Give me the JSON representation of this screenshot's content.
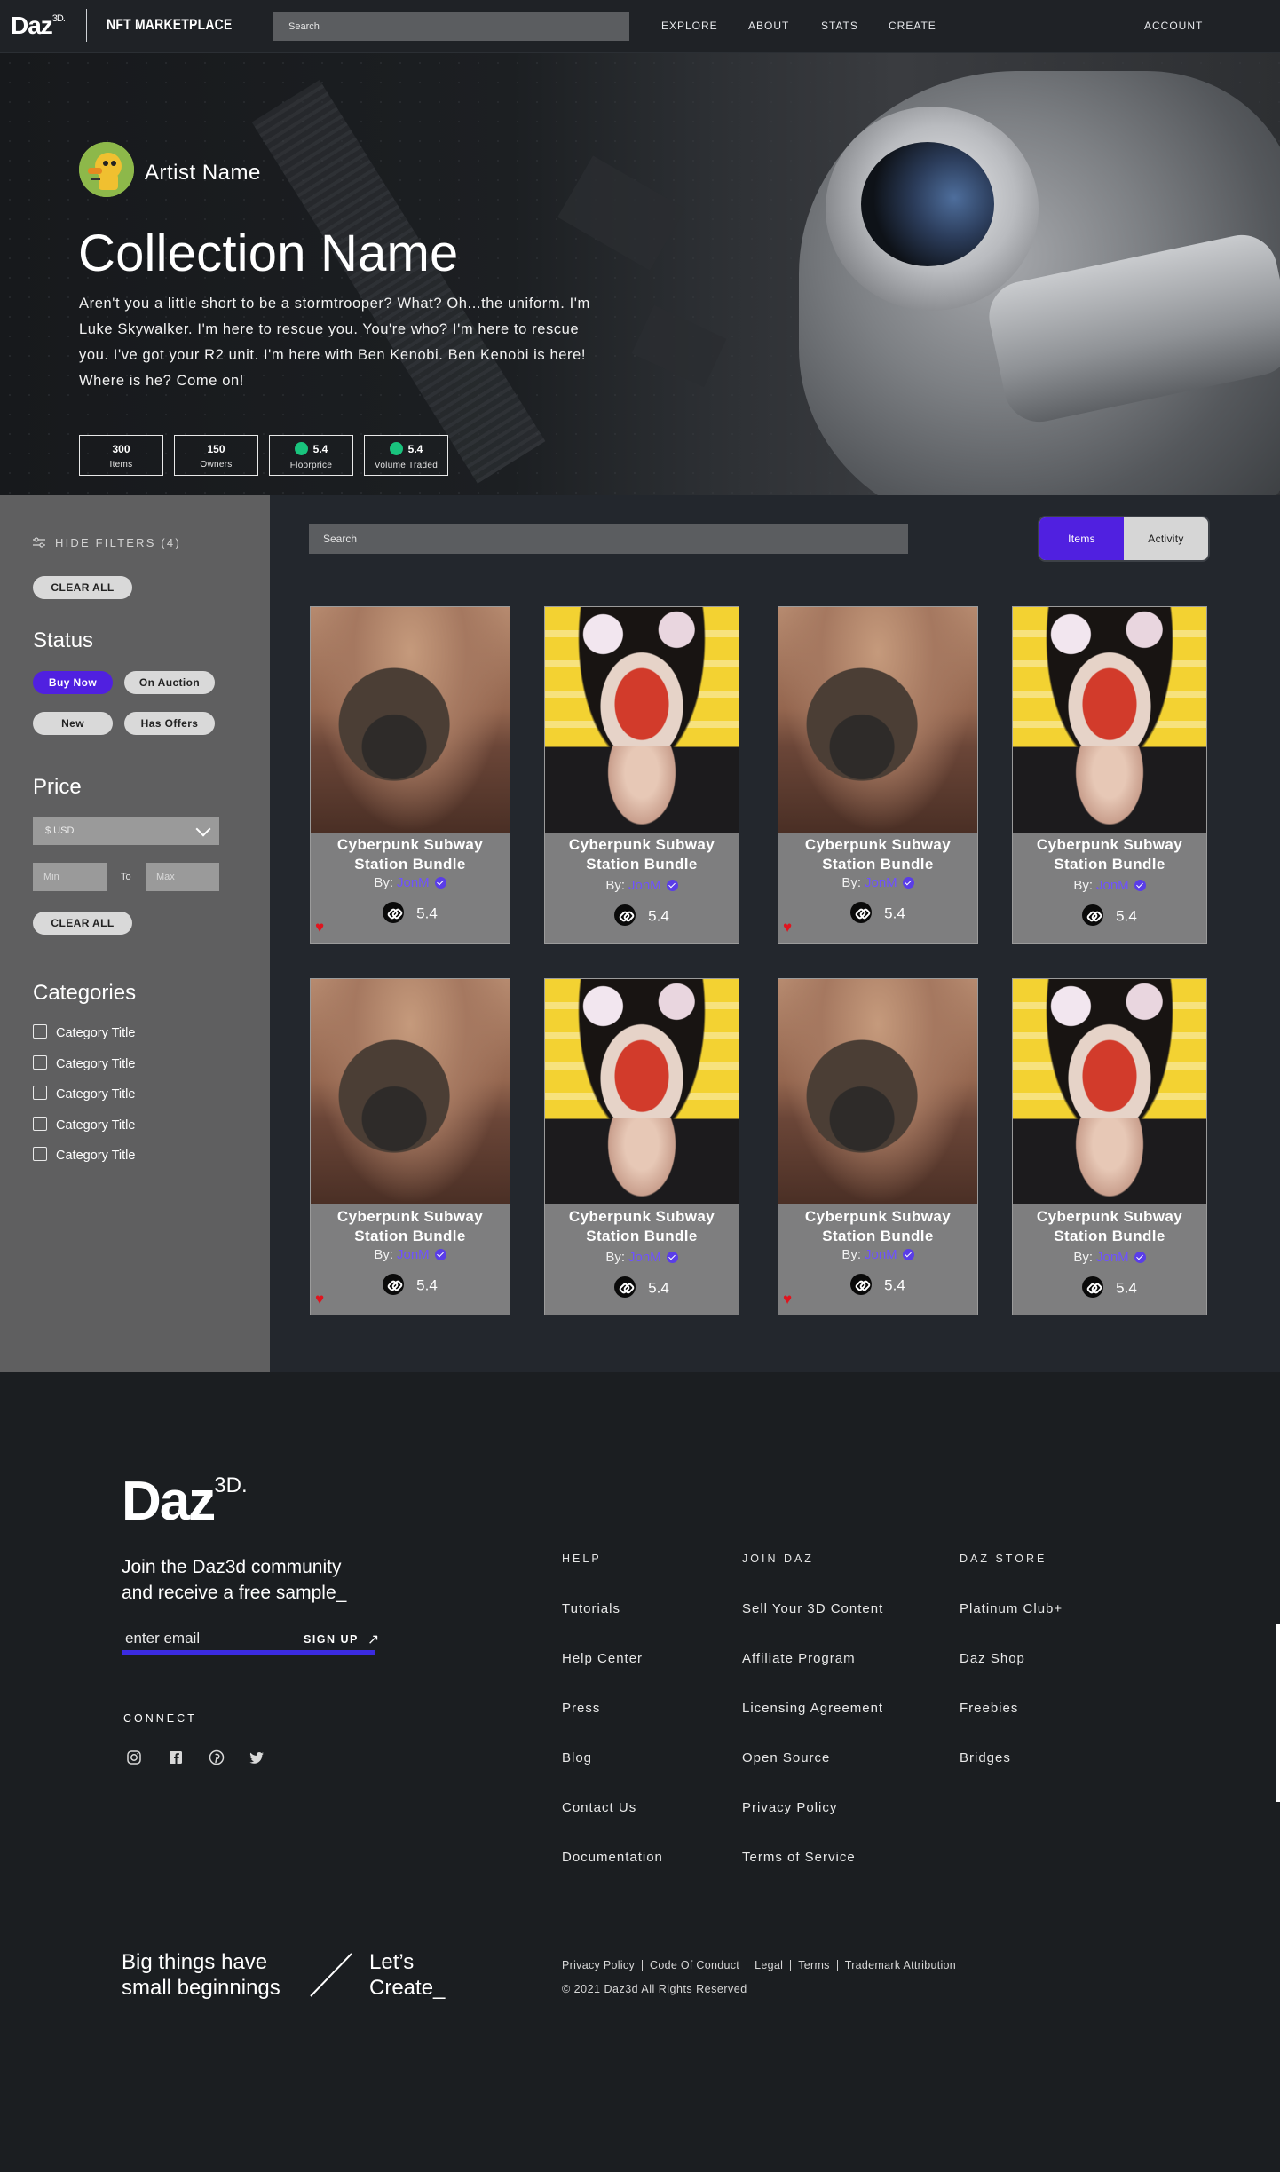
{
  "nav": {
    "logo": "Daz",
    "logo_sup": "3D.",
    "brand": "NFT MARKETPLACE",
    "search_placeholder": "Search",
    "links": [
      "EXPLORE",
      "ABOUT",
      "STATS",
      "CREATE"
    ],
    "account": "ACCOUNT"
  },
  "hero": {
    "artist_name": "Artist Name",
    "collection_name": "Collection Name",
    "description": "Aren't you a little short to be a stormtrooper? What? Oh...the uniform. I'm Luke Skywalker. I'm here to rescue you. You're who? I'm here to rescue you. I've got your R2 unit. I'm here with Ben Kenobi. Ben Kenobi is here! Where is he? Come on!",
    "stats": [
      {
        "value": "300",
        "label": "Items"
      },
      {
        "value": "150",
        "label": "Owners"
      },
      {
        "value": "5.4",
        "label": "Floorprice"
      },
      {
        "value": "5.4",
        "label": "Volume Traded"
      }
    ]
  },
  "filters": {
    "hide_filters": "HIDE FILTERS (4)",
    "clear_all": "CLEAR ALL",
    "status_heading": "Status",
    "status_options": [
      "Buy Now",
      "On Auction",
      "New",
      "Has Offers"
    ],
    "price_heading": "Price",
    "currency": "$ USD",
    "min_placeholder": "Min",
    "to": "To",
    "max_placeholder": "Max",
    "price_clear_all": "CLEAR ALL",
    "categories_heading": "Categories",
    "categories": [
      "Category Title",
      "Category Title",
      "Category Title",
      "Category Title",
      "Category Title"
    ]
  },
  "main": {
    "search_placeholder": "Search",
    "tabs": [
      "Items",
      "Activity"
    ]
  },
  "cards": [
    {
      "title": "Cyberpunk Subway Station Bundle",
      "by": "By:",
      "author": "JonM",
      "price": "5.4",
      "image": "desert-capsule",
      "liked": true
    },
    {
      "title": "Cyberpunk Subway Station Bundle",
      "by": "By:",
      "author": "JonM",
      "price": "5.4",
      "image": "geisha-portrait",
      "liked": false
    },
    {
      "title": "Cyberpunk Subway Station Bundle",
      "by": "By:",
      "author": "JonM",
      "price": "5.4",
      "image": "desert-capsule",
      "liked": true
    },
    {
      "title": "Cyberpunk Subway Station Bundle",
      "by": "By:",
      "author": "JonM",
      "price": "5.4",
      "image": "geisha-portrait",
      "liked": false
    },
    {
      "title": "Cyberpunk Subway Station Bundle",
      "by": "By:",
      "author": "JonM",
      "price": "5.4",
      "image": "desert-capsule",
      "liked": true
    },
    {
      "title": "Cyberpunk Subway Station Bundle",
      "by": "By:",
      "author": "JonM",
      "price": "5.4",
      "image": "geisha-portrait",
      "liked": false
    },
    {
      "title": "Cyberpunk Subway Station Bundle",
      "by": "By:",
      "author": "JonM",
      "price": "5.4",
      "image": "desert-capsule",
      "liked": true
    },
    {
      "title": "Cyberpunk Subway Station Bundle",
      "by": "By:",
      "author": "JonM",
      "price": "5.4",
      "image": "geisha-portrait",
      "liked": false
    }
  ],
  "footer": {
    "logo": "Daz",
    "logo_sup": "3D.",
    "join_line1": "Join the Daz3d community",
    "join_line2": "and receive a free sample_",
    "email_placeholder": "enter email",
    "sign_up": "SIGN UP",
    "connect": "CONNECT",
    "social_icons": [
      "instagram-icon",
      "facebook-icon",
      "pinterest-icon",
      "twitter-icon"
    ],
    "columns": [
      {
        "heading": "HELP",
        "links": [
          "Tutorials",
          "Help Center",
          "Press",
          "Blog",
          "Contact Us",
          "Documentation"
        ]
      },
      {
        "heading": "JOIN DAZ",
        "links": [
          "Sell Your 3D Content",
          "Affiliate Program",
          "Licensing Agreement",
          "Open Source",
          "Privacy Policy",
          "Terms of Service"
        ]
      },
      {
        "heading": "DAZ STORE",
        "links": [
          "Platinum Club+",
          "Daz Shop",
          "Freebies",
          "Bridges"
        ]
      }
    ],
    "tagline_left_1": "Big things have",
    "tagline_left_2": "small beginnings",
    "tagline_right_1": "Let’s",
    "tagline_right_2": "Create_",
    "legal_links": [
      "Privacy Policy",
      "Code Of Conduct",
      "Legal",
      "Terms",
      "Trademark Attribution"
    ],
    "copyright": "© 2021 Daz3d All Rights Reserved"
  },
  "colors": {
    "accent": "#5020e0",
    "author_link": "#6f52ff",
    "heart": "#e0141e",
    "eth_green": "#19c37d",
    "page_bg": "#1a1d21"
  }
}
